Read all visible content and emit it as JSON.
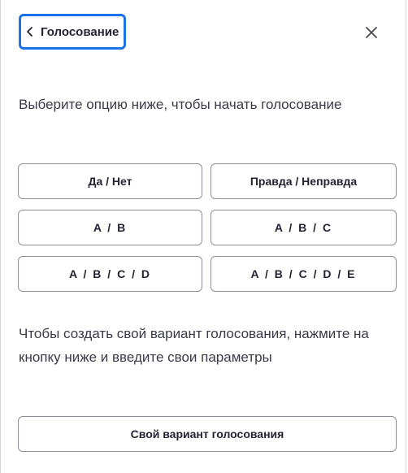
{
  "header": {
    "back_label": "Голосование",
    "back_icon": "chevron-left-icon",
    "close_icon": "close-icon",
    "focus_color": "#1a73e8"
  },
  "intro_text": "Выберите опцию ниже, чтобы начать голосование",
  "options": [
    {
      "label": "Да / Нет"
    },
    {
      "label": "Правда / Неправда"
    },
    {
      "label": "A / B"
    },
    {
      "label": "A / B / C"
    },
    {
      "label": "A / B / C / D"
    },
    {
      "label": "A / B / C / D / E"
    }
  ],
  "custom": {
    "text": "Чтобы создать свой вариант голосования, нажмите на кнопку ниже и введите свои параметры",
    "button_label": "Свой вариант голосования"
  }
}
